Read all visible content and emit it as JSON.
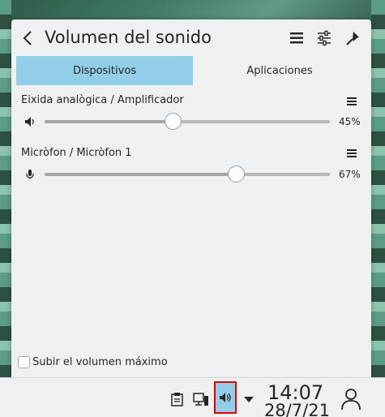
{
  "popup": {
    "title": "Volumen del sonido",
    "header_icons": [
      "back-icon",
      "hamburger-menu-icon",
      "settings-sliders-icon",
      "pin-icon"
    ]
  },
  "tabs": [
    {
      "label": "Dispositivos",
      "active": true
    },
    {
      "label": "Aplicaciones",
      "active": false
    }
  ],
  "devices": [
    {
      "name": "Eixida analògica / Amplificador",
      "icon": "speaker-icon",
      "volume_percent": 45,
      "volume_label": "45%"
    },
    {
      "name": "Micròfon / Micròfon 1",
      "icon": "microphone-icon",
      "volume_percent": 67,
      "volume_label": "67%"
    }
  ],
  "options": {
    "raise_max_volume_label": "Subir el volumen máximo",
    "raise_max_volume_checked": false
  },
  "taskbar": {
    "tray_icons": [
      "clipboard-icon",
      "network-icon",
      "volume-icon",
      "expand-arrow-icon"
    ],
    "time": "14:07",
    "date": "28/7/21",
    "user_icon": "user-icon"
  },
  "colors": {
    "accent": "#93cee9",
    "highlight_border": "#e00000",
    "panel_bg": "#eff0f1",
    "text": "#232629"
  }
}
